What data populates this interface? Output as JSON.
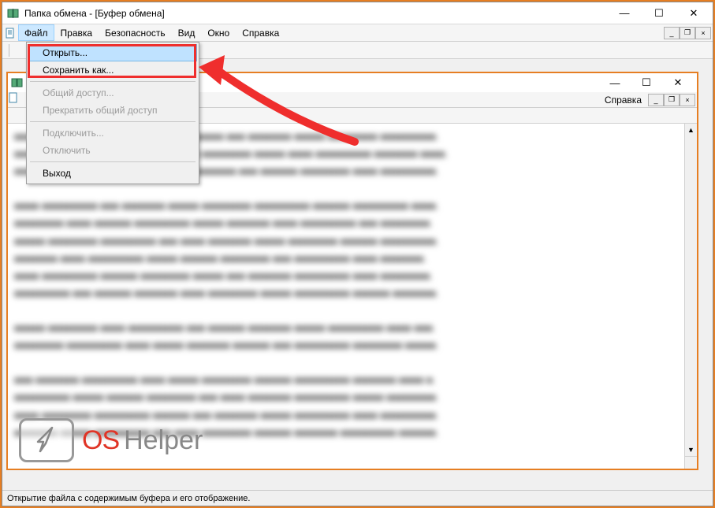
{
  "outer": {
    "title": "Папка обмена - [Буфер обмена]",
    "menus": {
      "file": "Файл",
      "edit": "Правка",
      "security": "Безопасность",
      "view": "Вид",
      "window": "Окно",
      "help": "Справка"
    },
    "window_controls": {
      "minimize": "—",
      "maximize": "☐",
      "close": "✕"
    },
    "mdi_controls": {
      "minimize": "_",
      "restore": "❐",
      "close": "×"
    }
  },
  "dropdown": {
    "open": "Открыть...",
    "save_as": "Сохранить как...",
    "share": "Общий доступ...",
    "stop_share": "Прекратить общий доступ",
    "connect": "Подключить...",
    "disconnect": "Отключить",
    "exit": "Выход"
  },
  "inner": {
    "title": "",
    "menus": {
      "help": "Справка"
    },
    "window_controls": {
      "minimize": "—",
      "maximize": "☐",
      "close": "✕"
    },
    "mdi_controls": {
      "minimize": "_",
      "restore": "❐",
      "close": "×"
    }
  },
  "watermark": {
    "os": "OS",
    "helper": "Helper"
  },
  "statusbar": "Открытие файла с содержимым буфера и его отображение."
}
